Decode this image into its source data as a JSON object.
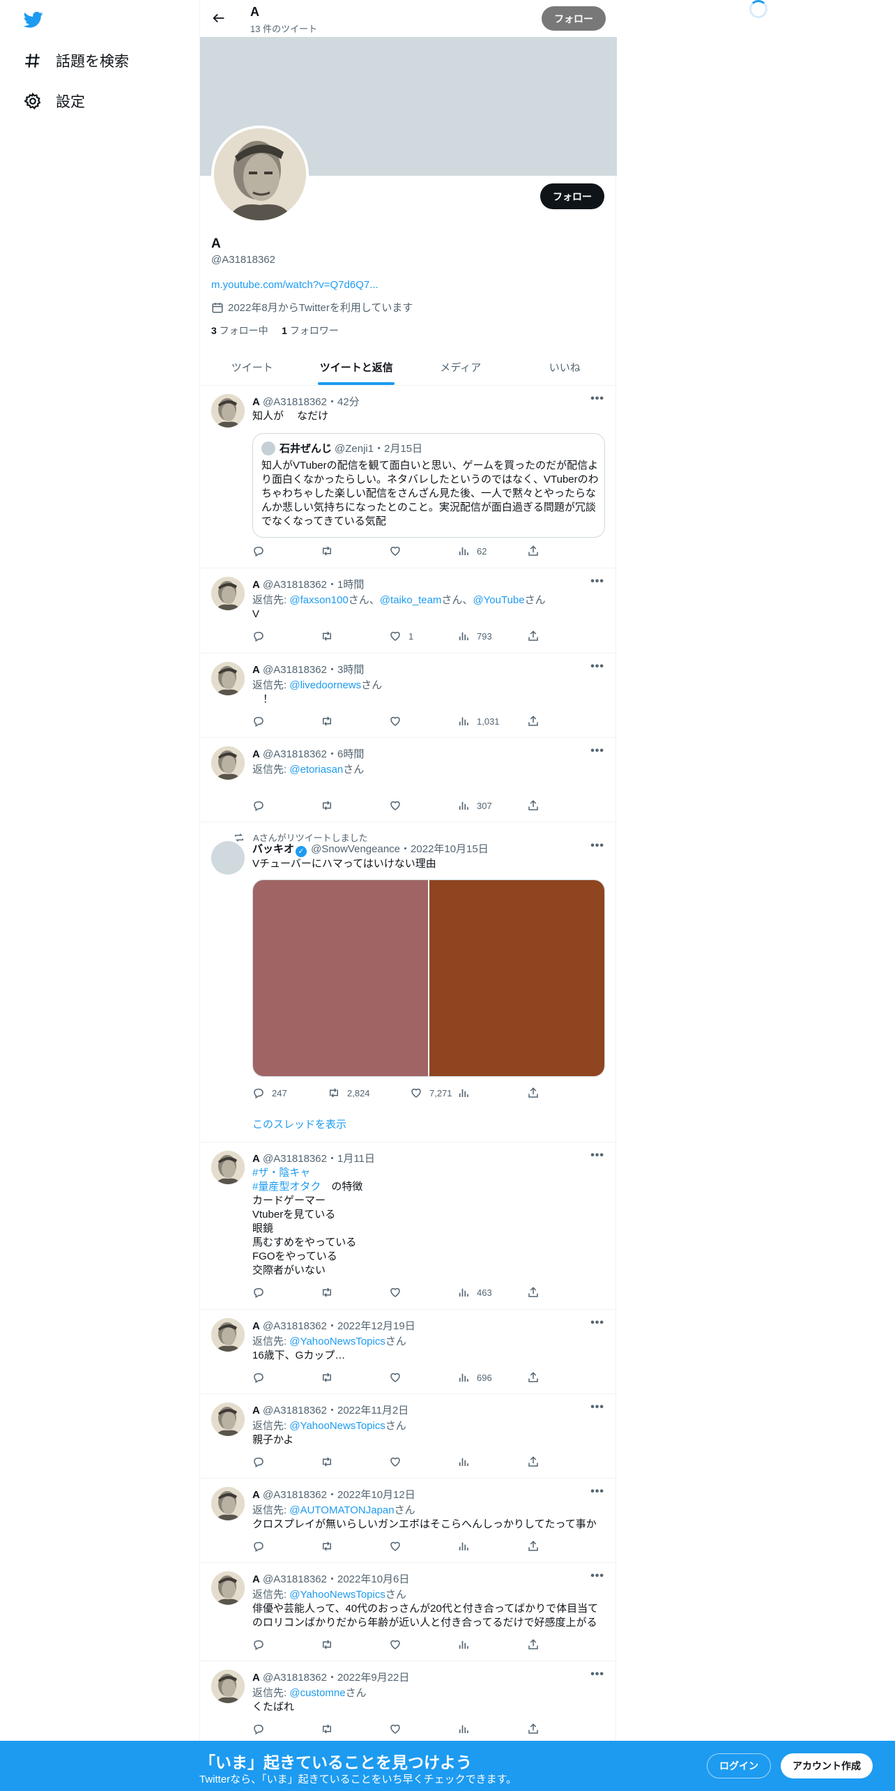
{
  "nav": {
    "explore_label": "話題を検索",
    "settings_label": "設定"
  },
  "header": {
    "name": "A",
    "tweet_count": "13 件のツイート",
    "follow_label": "フォロー"
  },
  "profile": {
    "follow_label": "フォロー",
    "name": "A",
    "handle": "@A31818362",
    "link": "m.youtube.com/watch?v=Q7d6Q7...",
    "joined": "2022年8月からTwitterを利用しています",
    "following_count": "3",
    "following_label": " フォロー中",
    "followers_count": "1",
    "followers_label": " フォロワー"
  },
  "tabs": [
    "ツイート",
    "ツイートと返信",
    "メディア",
    "いいね"
  ],
  "tweets": [
    {
      "name": "A",
      "meta": " @A31818362・42分",
      "text": "知人が　 なだけ",
      "quote": {
        "name": "石井ぜんじ",
        "meta": "@Zenji1・2月15日",
        "text": "知人がVTuberの配信を観て面白いと思い、ゲームを買ったのだが配信より面白くなかったらしい。ネタバレしたというのではなく、VTuberのわちゃわちゃした楽しい配信をさんざん見た後、一人で黙々とやったらなんか悲しい気持ちになったとのこと。実況配信が面白過ぎる問題が冗談でなくなってきている気配"
      },
      "views": "62"
    },
    {
      "name": "A",
      "meta": " @A31818362・1時間",
      "reply_prefix": "返信先: ",
      "mentions": [
        "@faxson100",
        "@taiko_team",
        "@YouTube"
      ],
      "text": "V",
      "likes": "1",
      "views": "793"
    },
    {
      "name": "A",
      "meta": " @A31818362・3時間",
      "reply_prefix": "返信先: ",
      "mentions": [
        "@livedoornews"
      ],
      "text": "　！",
      "views": "1,031"
    },
    {
      "name": "A",
      "meta": " @A31818362・6時間",
      "reply_prefix": "返信先: ",
      "mentions": [
        "@etoriasan"
      ],
      "views": "307"
    },
    {
      "retweet_label": "Aさんがリツイートしました",
      "name": "バッキオ",
      "meta": " @SnowVengeance・2022年10月15日",
      "text": "Vチューバーにハマってはいけない理由",
      "replies": "247",
      "retweets": "2,824",
      "likes": "7,271",
      "thread_link": "このスレッドを表示"
    },
    {
      "name": "A",
      "meta": " @A31818362・1月11日",
      "tag1": "#ザ・陰キャ",
      "tag2": "#量産型オタク",
      "tag2_suffix": "　の特徴",
      "text_rest": "カードゲーマー\nVtuberを見ている\n眼鏡\n馬むすめをやっている\nFGOをやっている\n交際者がいない",
      "views": "463"
    },
    {
      "name": "A",
      "meta": " @A31818362・2022年12月19日",
      "reply_prefix": "返信先: ",
      "mentions": [
        "@YahooNewsTopics"
      ],
      "text": "16歳下、Gカップ…",
      "views": "696"
    },
    {
      "name": "A",
      "meta": " @A31818362・2022年11月2日",
      "reply_prefix": "返信先: ",
      "mentions": [
        "@YahooNewsTopics"
      ],
      "text": "親子かよ"
    },
    {
      "name": "A",
      "meta": " @A31818362・2022年10月12日",
      "reply_prefix": "返信先: ",
      "mentions": [
        "@AUTOMATONJapan"
      ],
      "text": "クロスプレイが無いらしいガンエボはそこらへんしっかりしてたって事か"
    },
    {
      "name": "A",
      "meta": " @A31818362・2022年10月6日",
      "reply_prefix": "返信先: ",
      "mentions": [
        "@YahooNewsTopics"
      ],
      "text": "俳優や芸能人って、40代のおっさんが20代と付き合ってばかりで体目当てのロリコンばかりだから年齢が近い人と付き合ってるだけで好感度上がる"
    },
    {
      "name": "A",
      "meta": " @A31818362・2022年9月22日",
      "reply_prefix": "返信先: ",
      "mentions": [
        "@customne"
      ],
      "text": "くたばれ"
    }
  ],
  "mention_suffix": "さん",
  "mention_sep": "さん、",
  "bottom": {
    "title": "「いま」起きていることを見つけよう",
    "subtitle": "Twitterなら、「いま」起きていることをいち早くチェックできます。",
    "login_label": "ログイン",
    "signup_label": "アカウント作成"
  },
  "colors": {
    "accent": "#1d9bf0",
    "banner": "#cfd9de",
    "media_left": "#a06464",
    "media_right": "#8e4520"
  }
}
